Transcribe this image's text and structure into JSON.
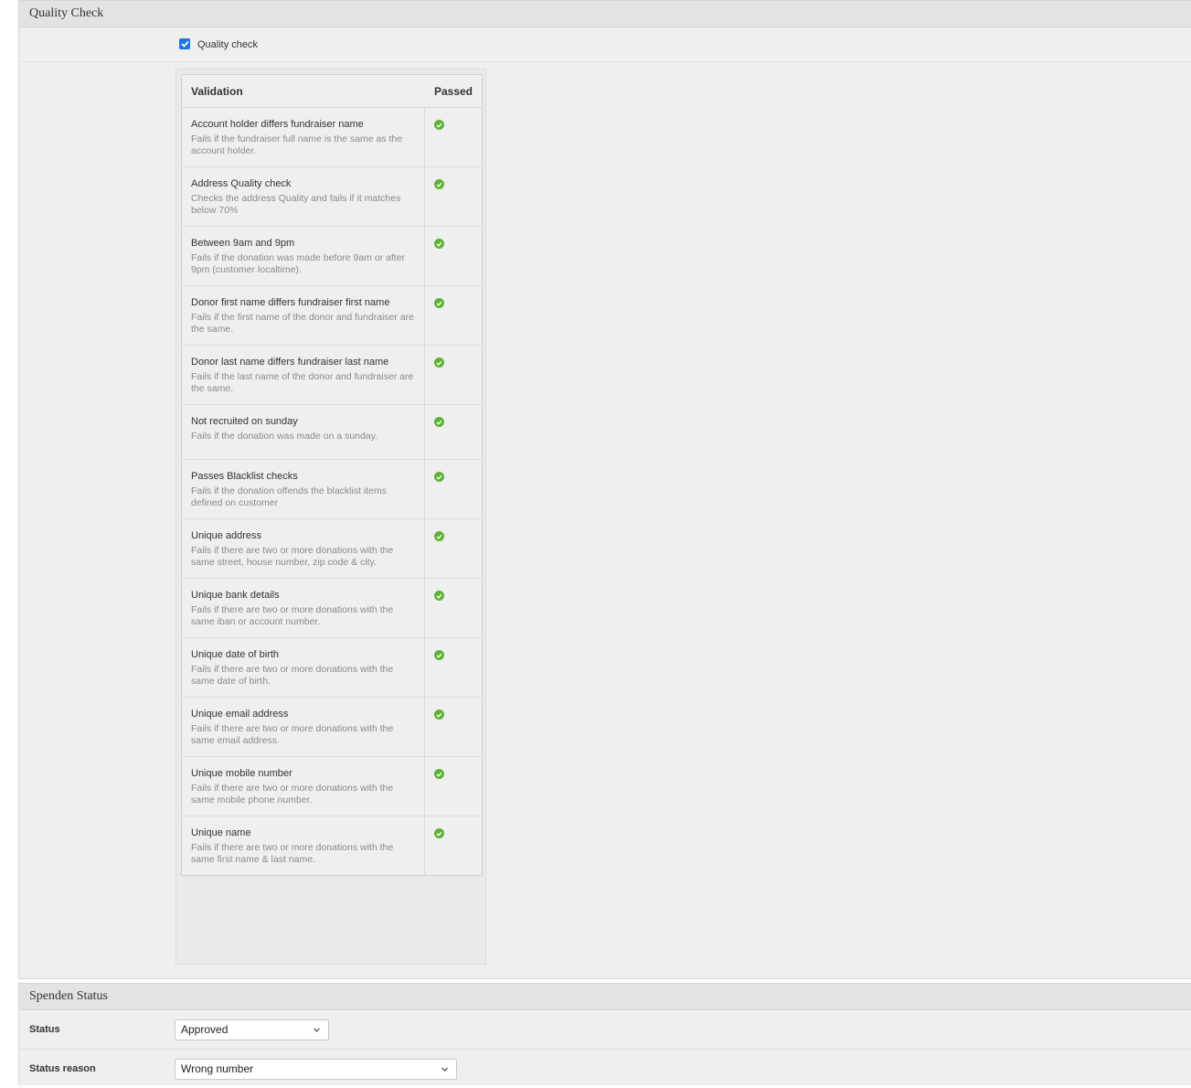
{
  "quality_panel": {
    "title": "Quality Check",
    "checkbox_label": "Quality check",
    "checkbox_checked": true
  },
  "validation_table": {
    "col_validation": "Validation",
    "col_passed": "Passed",
    "rows": [
      {
        "title": "Account holder differs fundraiser name",
        "desc": "Fails if the fundraiser full name is the same as the account holder.",
        "passed": true
      },
      {
        "title": "Address Quality check",
        "desc": "Checks the address Quality and fails if it matches below 70%",
        "passed": true
      },
      {
        "title": "Between 9am and 9pm",
        "desc": "Fails if the donation was made before 9am or after 9pm (customer localtime).",
        "passed": true
      },
      {
        "title": "Donor first name differs fundraiser first name",
        "desc": "Fails if the first name of the donor and fundraiser are the same.",
        "passed": true
      },
      {
        "title": "Donor last name differs fundraiser last name",
        "desc": "Fails if the last name of the donor and fundraiser are the same.",
        "passed": true
      },
      {
        "title": "Not recruited on sunday",
        "desc": "Fails if the donation was made on a sunday.",
        "passed": true
      },
      {
        "title": "Passes Blacklist checks",
        "desc": "Fails if the donation offends the blacklist items defined on customer",
        "passed": true
      },
      {
        "title": "Unique address",
        "desc": "Fails if there are two or more donations with the same street, house number, zip code & city.",
        "passed": true
      },
      {
        "title": "Unique bank details",
        "desc": "Fails if there are two or more donations with the same iban or account number.",
        "passed": true
      },
      {
        "title": "Unique date of birth",
        "desc": "Fails if there are two or more donations with the same date of birth.",
        "passed": true
      },
      {
        "title": "Unique email address",
        "desc": "Fails if there are two or more donations with the same email address.",
        "passed": true
      },
      {
        "title": "Unique mobile number",
        "desc": "Fails if there are two or more donations with the same mobile phone number.",
        "passed": true
      },
      {
        "title": "Unique name",
        "desc": "Fails if there are two or more donations with the same first name & last name.",
        "passed": true
      }
    ]
  },
  "status_panel": {
    "title": "Spenden Status",
    "status_label": "Status",
    "status_value": "Approved",
    "reason_label": "Status reason",
    "reason_value": "Wrong number"
  },
  "icons": {
    "passed": "check-circle-icon",
    "checkbox": "checkmark-icon",
    "dropdown": "chevron-down-icon"
  },
  "colors": {
    "passed_green": "#5fb236",
    "checkbox_blue": "#1e74e0"
  }
}
